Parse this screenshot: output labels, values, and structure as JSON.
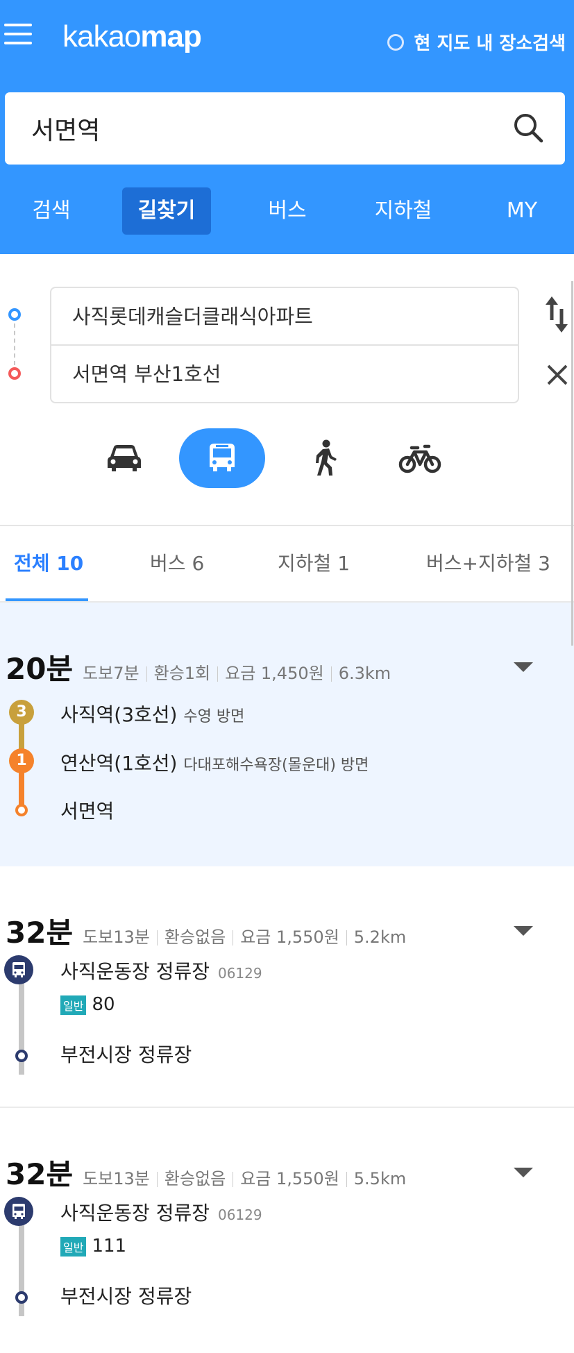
{
  "header": {
    "logo_light": "kakao",
    "logo_bold": "map",
    "area_search_label": "현 지도 내 장소검색",
    "search_value": "서면역",
    "tabs": [
      "검색",
      "길찾기",
      "버스",
      "지하철",
      "MY"
    ],
    "active_tab": "길찾기",
    "bg_color": "#3396ff"
  },
  "route": {
    "origin": "사직롯데캐슬더클래식아파트",
    "destination": "서면역 부산1호선",
    "modes": [
      "car-icon",
      "bus-icon",
      "walk-icon",
      "bike-icon"
    ],
    "active_mode": "bus-icon"
  },
  "filters": [
    {
      "label": "전체",
      "count": "10"
    },
    {
      "label": "버스",
      "count": "6"
    },
    {
      "label": "지하철",
      "count": "1"
    },
    {
      "label": "버스+지하철",
      "count": "3"
    }
  ],
  "results": [
    {
      "time": "20분",
      "walk": "도보7분",
      "transfer": "환승1회",
      "fare": "요금 1,450원",
      "distance": "6.3km",
      "steps": [
        {
          "badge": "3",
          "badge_color": "#c8a03c",
          "name": "사직역(3호선)",
          "direction": "수영 방면"
        },
        {
          "badge": "1",
          "badge_color": "#f5822b",
          "name": "연산역(1호선)",
          "direction": "다대포해수욕장(몰운대) 방면"
        }
      ],
      "end": "서면역"
    },
    {
      "time": "32분",
      "walk": "도보13분",
      "transfer": "환승없음",
      "fare": "요금 1,550원",
      "distance": "5.2km",
      "stop": "사직운동장 정류장",
      "stop_code": "06129",
      "bus_type": "일반",
      "bus_no": "80",
      "end": "부전시장 정류장"
    },
    {
      "time": "32분",
      "walk": "도보13분",
      "transfer": "환승없음",
      "fare": "요금 1,550원",
      "distance": "5.5km",
      "stop": "사직운동장 정류장",
      "stop_code": "06129",
      "bus_type": "일반",
      "bus_no": "111",
      "end": "부전시장 정류장"
    }
  ]
}
